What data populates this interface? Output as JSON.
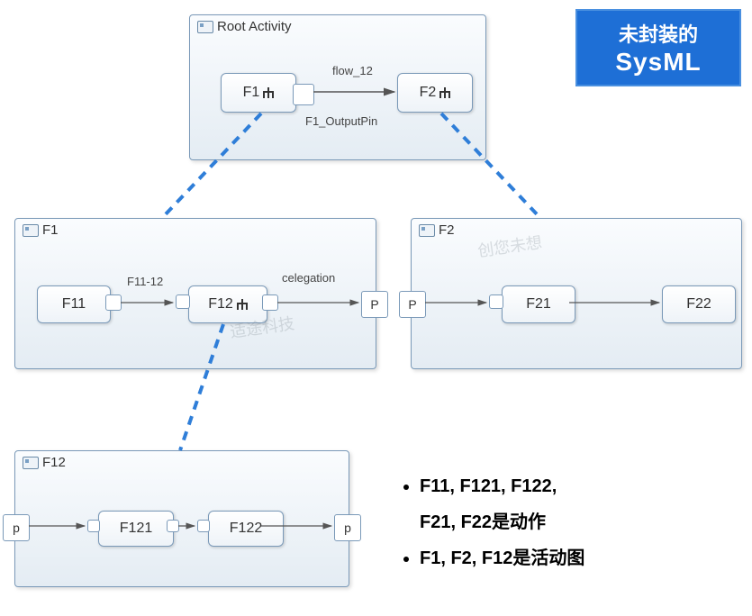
{
  "badge": {
    "line1": "未封装的",
    "line2": "SysML"
  },
  "root": {
    "title": "Root Activity",
    "n1": "F1",
    "n2": "F2",
    "flow": "flow_12",
    "outpin": "F1_OutputPin"
  },
  "f1": {
    "title": "F1",
    "n1": "F11",
    "n2": "F12",
    "edge": "F11-12",
    "deleg": "celegation",
    "port": "P"
  },
  "f2": {
    "title": "F2",
    "n1": "F21",
    "n2": "F22",
    "port": "P"
  },
  "f12": {
    "title": "F12",
    "n1": "F121",
    "n2": "F122",
    "portL": "p",
    "portR": "p"
  },
  "bullets": {
    "b1a": "F11, F121, F122,",
    "b1b": "F21, F22是动作",
    "b2": "F1, F2, F12是活动图"
  },
  "watermarks": {
    "w1": "创您未想",
    "w2": "适途科技"
  }
}
